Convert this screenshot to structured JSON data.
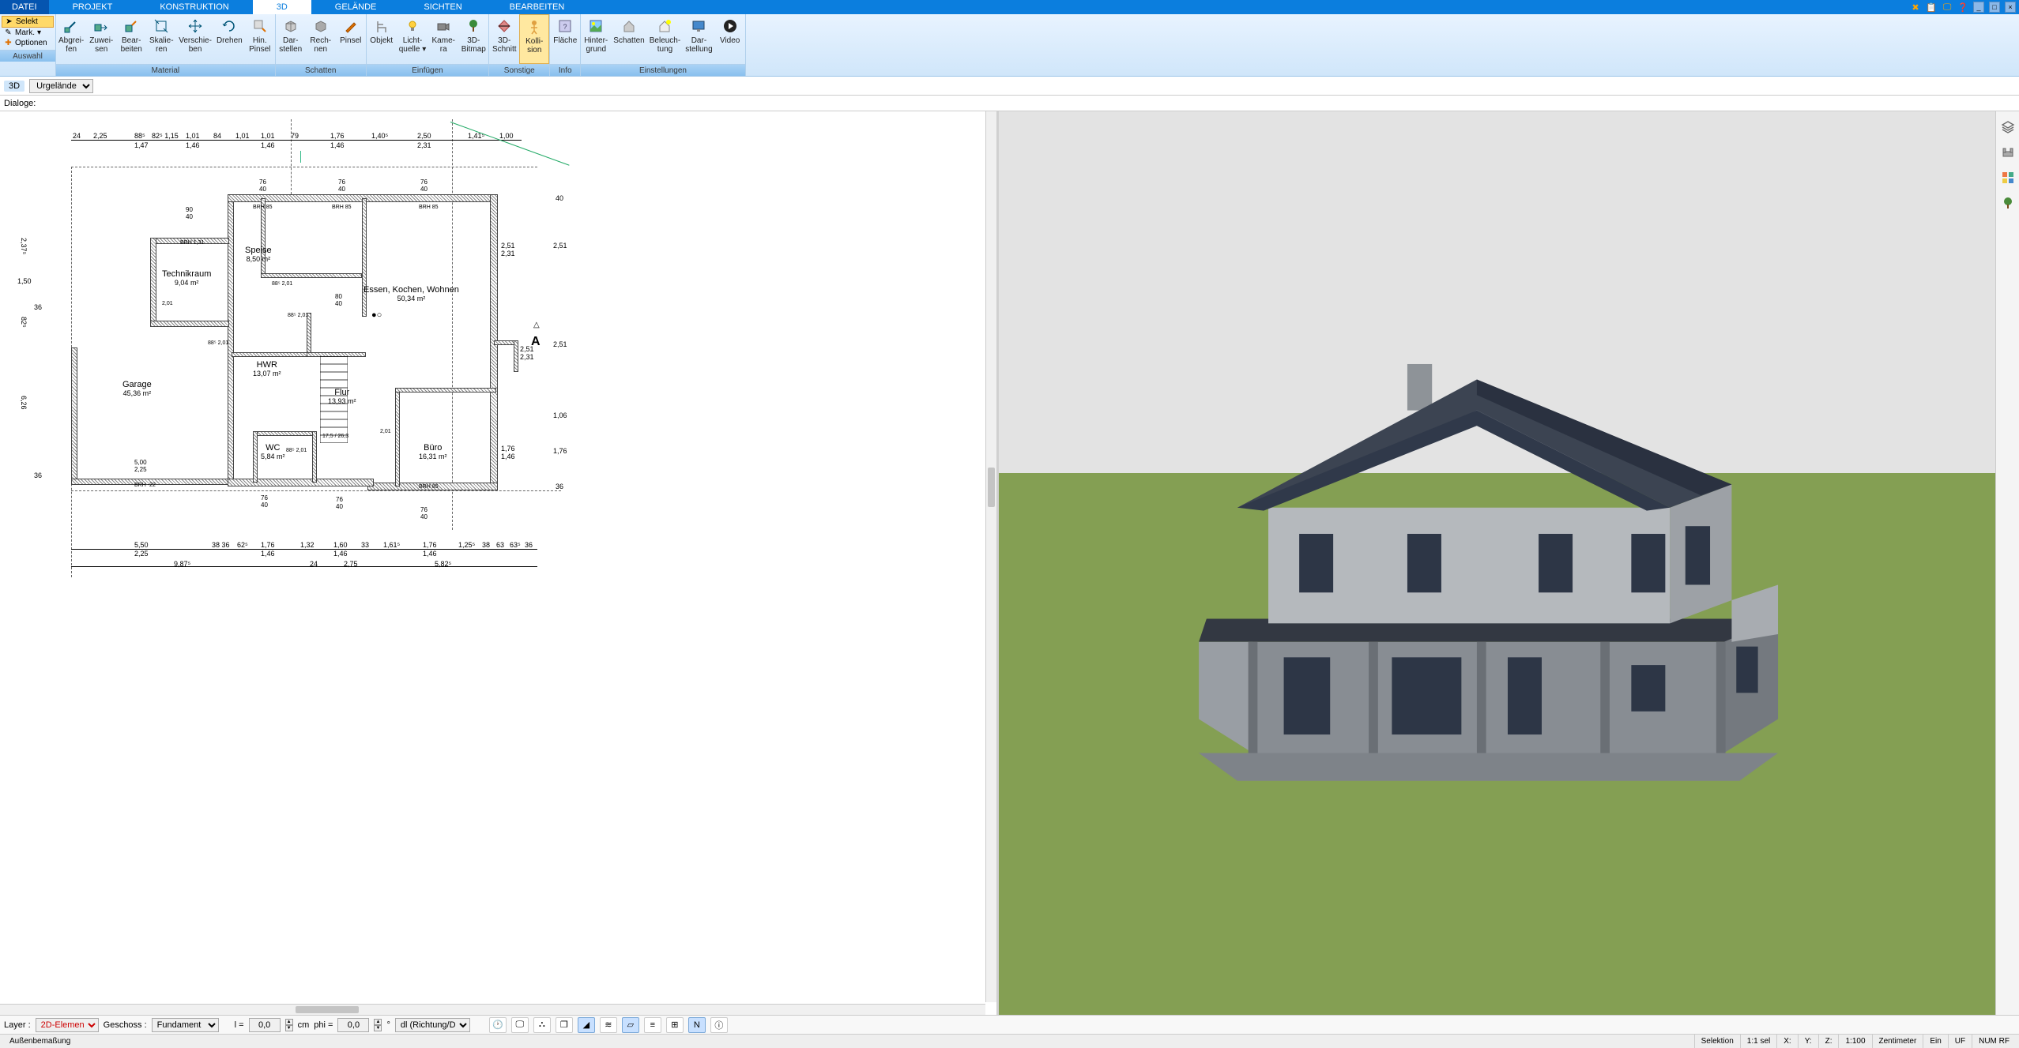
{
  "menu": {
    "file": "DATEI",
    "tabs": [
      "PROJEKT",
      "KONSTRUKTION",
      "3D",
      "GELÄNDE",
      "SICHTEN",
      "BEARBEITEN"
    ],
    "activeTab": "3D"
  },
  "auswahl_group": {
    "label": "Auswahl",
    "select": "Selekt",
    "mark": "Mark.",
    "optionen": "Optionen"
  },
  "ribbon": {
    "groups": [
      {
        "label": "Material",
        "buttons": [
          {
            "id": "abgreifen",
            "label": "Abgrei-\nfen"
          },
          {
            "id": "zuweisen",
            "label": "Zuwei-\nsen"
          },
          {
            "id": "bearbeiten",
            "label": "Bear-\nbeiten"
          },
          {
            "id": "skalieren",
            "label": "Skalie-\nren"
          },
          {
            "id": "verschieben",
            "label": "Verschie-\nben"
          },
          {
            "id": "drehen",
            "label": "Drehen"
          },
          {
            "id": "hinpinsel",
            "label": "Hin.\nPinsel"
          }
        ]
      },
      {
        "label": "Schatten",
        "buttons": [
          {
            "id": "darstellen",
            "label": "Dar-\nstellen"
          },
          {
            "id": "rechnen",
            "label": "Rech-\nnen"
          },
          {
            "id": "pinsel",
            "label": "Pinsel"
          }
        ]
      },
      {
        "label": "Einfügen",
        "buttons": [
          {
            "id": "objekt",
            "label": "Objekt"
          },
          {
            "id": "lichtquelle",
            "label": "Licht-\nquelle ▾"
          },
          {
            "id": "kamera",
            "label": "Kame-\nra"
          },
          {
            "id": "bitmap3d",
            "label": "3D-\nBitmap"
          }
        ]
      },
      {
        "label": "Sonstige",
        "buttons": [
          {
            "id": "schnitt3d",
            "label": "3D-\nSchnitt"
          },
          {
            "id": "kollision",
            "label": "Kolli-\nsion",
            "selected": true
          }
        ]
      },
      {
        "label": "Info",
        "buttons": [
          {
            "id": "flaeche",
            "label": "Fläche"
          }
        ]
      },
      {
        "label": "Einstellungen",
        "buttons": [
          {
            "id": "hintergrund",
            "label": "Hinter-\ngrund"
          },
          {
            "id": "schatten_set",
            "label": "Schatten"
          },
          {
            "id": "beleuchtung",
            "label": "Beleuch-\ntung"
          },
          {
            "id": "darstellung",
            "label": "Dar-\nstellung"
          },
          {
            "id": "video",
            "label": "Video"
          }
        ]
      }
    ]
  },
  "subbar": {
    "tag3d": "3D",
    "terrain_select": "Urgelände"
  },
  "dialoge": {
    "label": "Dialoge:"
  },
  "rooms": {
    "technikraum": {
      "name": "Technikraum",
      "area": "9,04 m²"
    },
    "speise": {
      "name": "Speise",
      "area": "8,50 m²"
    },
    "essen": {
      "name": "Essen, Kochen, Wohnen",
      "area": "50,34 m²"
    },
    "garage": {
      "name": "Garage",
      "area": "45,36 m²"
    },
    "hwr": {
      "name": "HWR",
      "area": "13,07 m²"
    },
    "flur": {
      "name": "Flur",
      "area": "13,93 m²"
    },
    "wc": {
      "name": "WC",
      "area": "5,84 m²"
    },
    "buero": {
      "name": "Büro",
      "area": "16,31 m²"
    }
  },
  "dimensions": {
    "top_row": [
      "24",
      "2,25",
      "88⁵",
      "82⁵ 1,15",
      "1,01",
      "84",
      "1,01",
      "1,01",
      "79",
      "1,76",
      "1,40⁵",
      "2,50",
      "1,41⁵",
      "1,00"
    ],
    "top_row2": [
      "",
      "",
      "1,47",
      "",
      "1,46",
      "",
      "",
      "1,46",
      "",
      "1,46",
      "",
      "2,31",
      "",
      ""
    ],
    "bottom_row1": [
      "5,50",
      "38 36",
      "62⁵",
      "1,76",
      "1,32",
      "1,60",
      "33",
      "1,61⁵",
      "1,76",
      "1,25⁵",
      "38",
      "63",
      "63⁵",
      "36"
    ],
    "bottom_row1b": [
      "2,25",
      "",
      "",
      "1,46",
      "",
      "1,46",
      "",
      "",
      "1,46",
      "",
      "",
      "",
      "",
      ""
    ],
    "bottom_row2": [
      "9,87⁵",
      "24",
      "2,75",
      "5,82⁵"
    ],
    "left_col": [
      "2,37⁵",
      "1,50",
      "82⁵",
      "6,26"
    ],
    "left_col_inner": [
      "36",
      "36"
    ],
    "right_col": [
      "40",
      "2,51",
      "2,51",
      "1,06",
      "1,76",
      "36"
    ],
    "right_col2": [
      "2,51",
      "2,31",
      "2,51",
      "2,31",
      "1,76",
      "1,46"
    ],
    "brh": "BRH 85",
    "brh22": "BRH -22",
    "door_marks": [
      "88⁵ 2,01",
      "88⁵ 2,01",
      "88⁵ 2,01",
      "88⁵ 2,01",
      "2,01",
      "2,01"
    ],
    "stair_text": "17,5 / 26,3",
    "A_symbol": "A"
  },
  "bottombar": {
    "layer_label": "Layer :",
    "layer_value": "2D-Elemen",
    "geschoss_label": "Geschoss :",
    "geschoss_value": "Fundament",
    "l_label": "l =",
    "l_value": "0,0",
    "cm": "cm",
    "phi_label": "phi =",
    "phi_value": "0,0",
    "deg": "°",
    "mode_value": "dl (Richtung/Di"
  },
  "status": {
    "left": "Außenbemaßung",
    "selektion": "Selektion",
    "scale": "1:1 sel",
    "x": "X:",
    "y": "Y:",
    "z": "Z:",
    "mscale": "1:100",
    "unit": "Zentimeter",
    "ein": "Ein",
    "uf": "UF",
    "numr": "NUM RF"
  }
}
